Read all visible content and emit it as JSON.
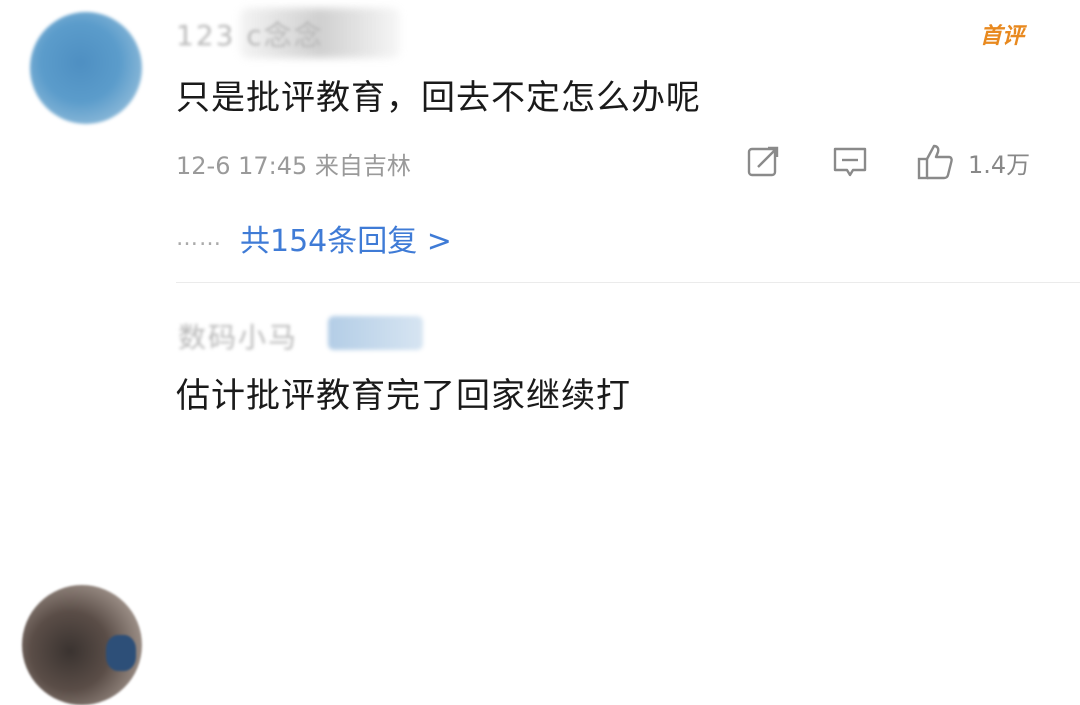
{
  "comments": [
    {
      "username": "123 c念念",
      "badge": "首评",
      "text": "只是批评教育，回去不定怎么办呢",
      "meta": "12-6 17:45 来自吉林",
      "likes": "1.4万",
      "reply_dots": "……",
      "replies_label": "共154条回复 >"
    },
    {
      "username": "数码小马",
      "text": "估计批评教育完了回家继续打"
    }
  ],
  "icons": {
    "share": "share-icon",
    "reply": "comment-icon",
    "like": "thumbs-up-icon"
  },
  "colors": {
    "badge": "#e8891f",
    "link": "#3f7bd6",
    "meta": "#9a9a9a"
  }
}
